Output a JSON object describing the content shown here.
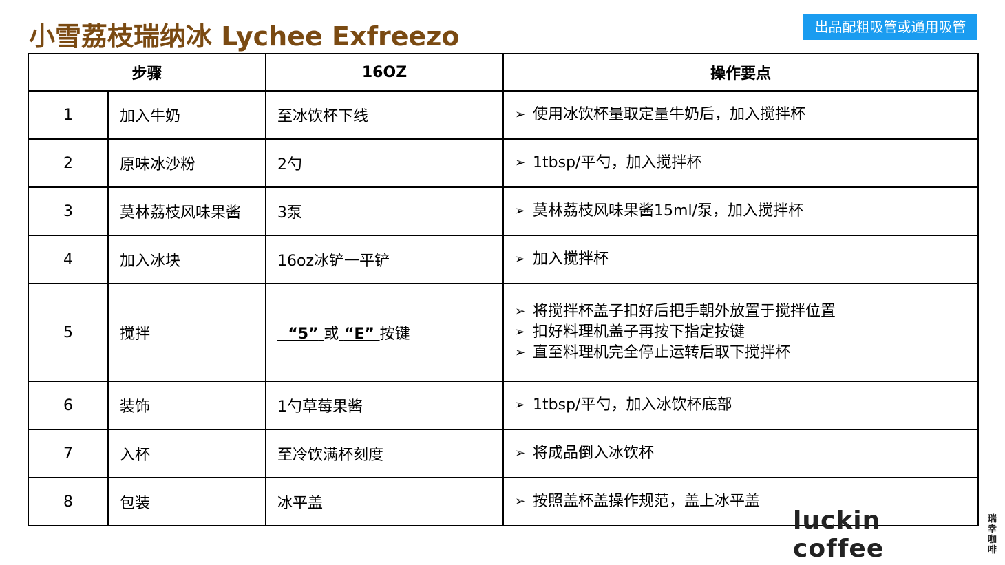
{
  "title": "小雪荔枝瑞纳冰 Lychee Exfreezo",
  "badge": "出品配粗吸管或通用吸管",
  "table": {
    "headers": {
      "step": "步骤",
      "size": "16OZ",
      "notes": "操作要点"
    },
    "rows": [
      {
        "num": "1",
        "name": "加入牛奶",
        "qty": "至冰饮杯下线",
        "notes": [
          "使用冰饮杯量取定量牛奶后，加入搅拌杯"
        ]
      },
      {
        "num": "2",
        "name": "原味冰沙粉",
        "qty": "2勺",
        "notes": [
          "1tbsp/平勺，加入搅拌杯"
        ]
      },
      {
        "num": "3",
        "name": "莫林荔枝风味果酱",
        "qty": "3泵",
        "notes": [
          "莫林荔枝风味果酱15ml/泵，加入搅拌杯"
        ]
      },
      {
        "num": "4",
        "name": "加入冰块",
        "qty": "16oz冰铲一平铲",
        "notes": [
          "加入搅拌杯"
        ]
      },
      {
        "num": "5",
        "name": "搅拌",
        "qty_parts": {
          "q1": "“5”",
          "or": "或",
          "q2": "“E”",
          "suffix": "按键"
        },
        "notes": [
          "将搅拌杯盖子扣好后把手朝外放置于搅拌位置",
          "扣好料理机盖子再按下指定按键",
          "直至料理机完全停止运转后取下搅拌杯"
        ]
      },
      {
        "num": "6",
        "name": "装饰",
        "qty": "1勺草莓果酱",
        "notes": [
          "1tbsp/平勺，加入冰饮杯底部"
        ]
      },
      {
        "num": "7",
        "name": "入杯",
        "qty": "至冷饮满杯刻度",
        "notes": [
          "将成品倒入冰饮杯"
        ]
      },
      {
        "num": "8",
        "name": "包装",
        "qty": "冰平盖",
        "notes": [
          "按照盖杯盖操作规范，盖上冰平盖"
        ]
      }
    ]
  },
  "bullet_icon": "arrowhead-bullet-icon",
  "logo": {
    "text": "luckin coffee",
    "cn_line1": "瑞幸",
    "cn_line2": "咖啡"
  },
  "colors": {
    "title": "#7a4a12",
    "badge_bg": "#1a9cf0",
    "badge_text": "#ffffff"
  }
}
